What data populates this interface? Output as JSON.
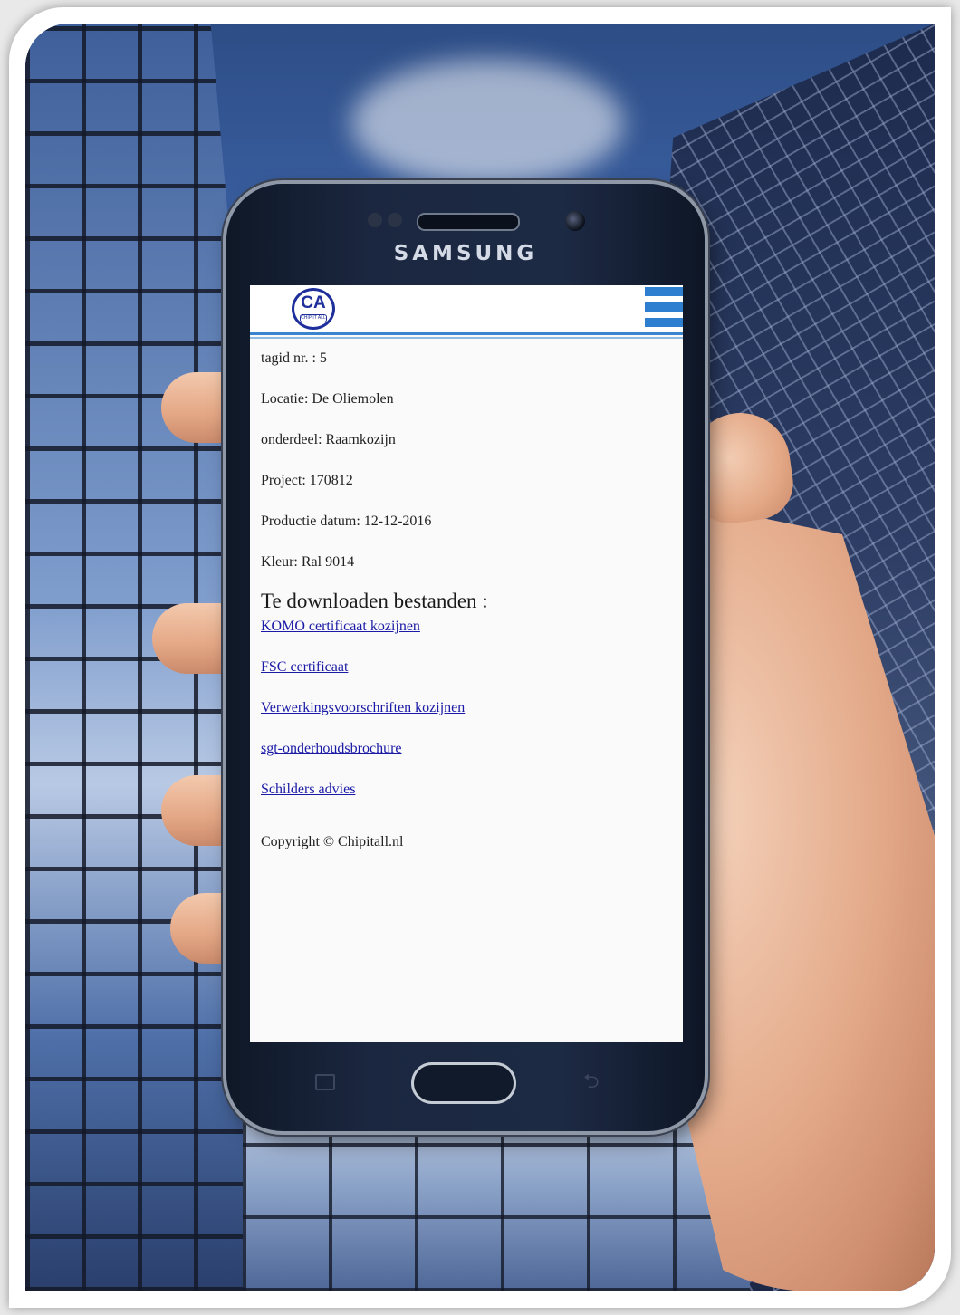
{
  "device": {
    "brand": "SAMSUNG"
  },
  "site": {
    "logo": {
      "mark": "CA",
      "text": "CHIP IT ALL"
    },
    "menu_icon": "hamburger-menu-icon"
  },
  "tag": {
    "fields": [
      {
        "label": "tagid nr. : 5"
      },
      {
        "label": "Locatie: De Oliemolen"
      },
      {
        "label": "onderdeel: Raamkozijn"
      },
      {
        "label": "Project: 170812"
      },
      {
        "label": "Productie datum: 12-12-2016"
      },
      {
        "label": "Kleur: Ral 9014"
      }
    ]
  },
  "downloads": {
    "title": "Te downloaden bestanden :",
    "links": [
      "KOMO certificaat kozijnen",
      "FSC certificaat",
      "Verwerkingsvoorschriften kozijnen",
      "sgt-onderhoudsbrochure",
      "Schilders advies"
    ]
  },
  "footer": {
    "copyright": "Copyright © Chipitall.nl"
  },
  "colors": {
    "accent": "#2f7fd0",
    "link": "#1a1aa6",
    "logo": "#1e2f9b"
  }
}
